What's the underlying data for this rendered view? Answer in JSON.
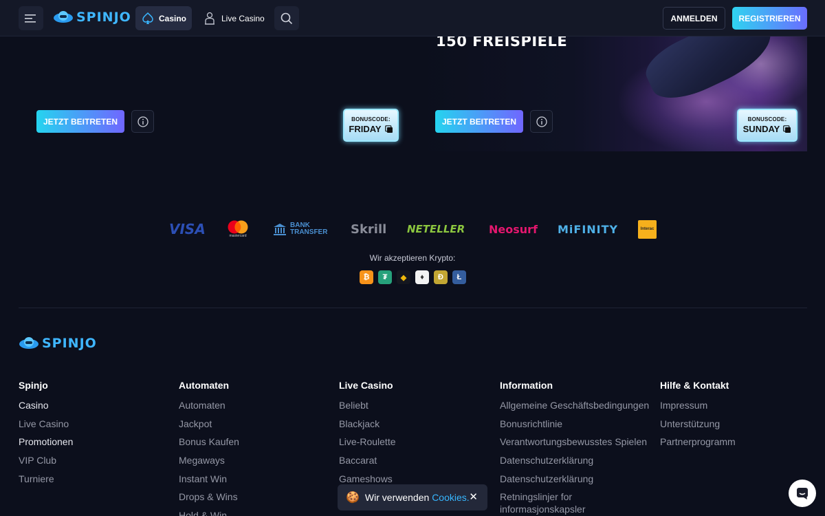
{
  "header": {
    "brand": "SPINJO",
    "nav": {
      "casino": "Casino",
      "live_casino": "Live Casino"
    },
    "login_label": "ANMELDEN",
    "register_label": "REGISTRIEREN"
  },
  "promos": [
    {
      "join_label": "JETZT BEITRETEN",
      "bonus_label": "BONUSCODE:",
      "bonus_code": "FRIDAY"
    },
    {
      "title": "150 FREISPIELE",
      "join_label": "JETZT BEITRETEN",
      "bonus_label": "BONUSCODE:",
      "bonus_code": "SUNDAY"
    }
  ],
  "payments": {
    "visa": "VISA",
    "mastercard": "mastercard",
    "bank_line1": "BANK",
    "bank_line2": "TRANSFER",
    "skrill": "Skrill",
    "neteller": "NETELLER",
    "neosurf": "Neosurf",
    "mifinity": "MiFINITY",
    "interac": "Interac",
    "crypto_label": "Wir akzeptieren Krypto:",
    "crypto": [
      "bitcoin-icon",
      "tether-icon",
      "binance-icon",
      "ethereum-icon",
      "dogecoin-icon",
      "litecoin-icon"
    ]
  },
  "footer": {
    "brand": "SPINJO",
    "columns": [
      {
        "title": "Spinjo",
        "links": [
          "Casino",
          "Live Casino",
          "Promotionen",
          "VIP Club",
          "Turniere"
        ]
      },
      {
        "title": "Automaten",
        "links": [
          "Automaten",
          "Jackpot",
          "Bonus Kaufen",
          "Megaways",
          "Instant Win",
          "Drops & Wins",
          "Hold & Win"
        ]
      },
      {
        "title": "Live Casino",
        "links": [
          "Beliebt",
          "Blackjack",
          "Live-Roulette",
          "Baccarat",
          "Gameshows"
        ]
      },
      {
        "title": "Information",
        "links": [
          "Allgemeine Geschäftsbedingungen",
          "Bonusrichtlinie",
          "Verantwortungsbewusstes Spielen",
          "Datenschutzerklärung",
          "Datenschutzerklärung",
          "Retningslinjer for informasjonskapsler"
        ]
      },
      {
        "title": "Hilfe & Kontakt",
        "links": [
          "Impressum",
          "Unterstützung",
          "Partnerprogramm"
        ]
      }
    ]
  },
  "cookie": {
    "text": "Wir verwenden",
    "link": "Cookies."
  },
  "colors": {
    "accent_start": "#2fd3f0",
    "accent_end": "#6a6dff",
    "background": "#0c0f1c",
    "link_blue": "#37b7ff"
  }
}
